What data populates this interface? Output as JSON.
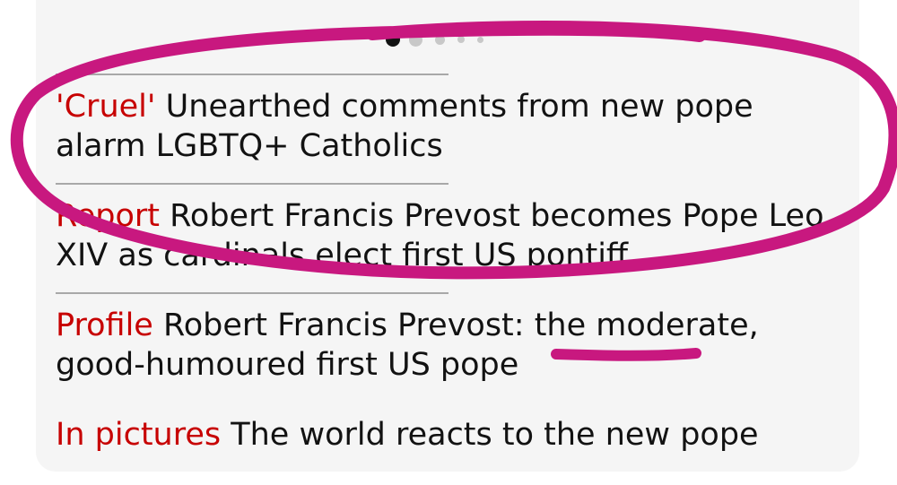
{
  "carousel": {
    "dot_count": 5,
    "active_index": 0
  },
  "links": [
    {
      "kicker": "'Cruel'",
      "headline": "Unearthed comments from new pope alarm LGBTQ+ Catholics"
    },
    {
      "kicker": "Report",
      "headline": "Robert Francis Prevost becomes Pope Leo XIV as cardinals elect first US pontiff"
    },
    {
      "kicker": "Profile",
      "headline": "Robert Francis Prevost: the moderate, good-humoured first US pope"
    },
    {
      "kicker": "In pictures",
      "headline": "The world reacts to the new pope"
    }
  ],
  "colors": {
    "kicker": "#c70000",
    "text": "#121212",
    "card_background": "#f5f5f5",
    "annotation": "#c8187f"
  },
  "annotations": {
    "ellipse_target": "links.0, links.1",
    "underline_target": "moderate"
  }
}
